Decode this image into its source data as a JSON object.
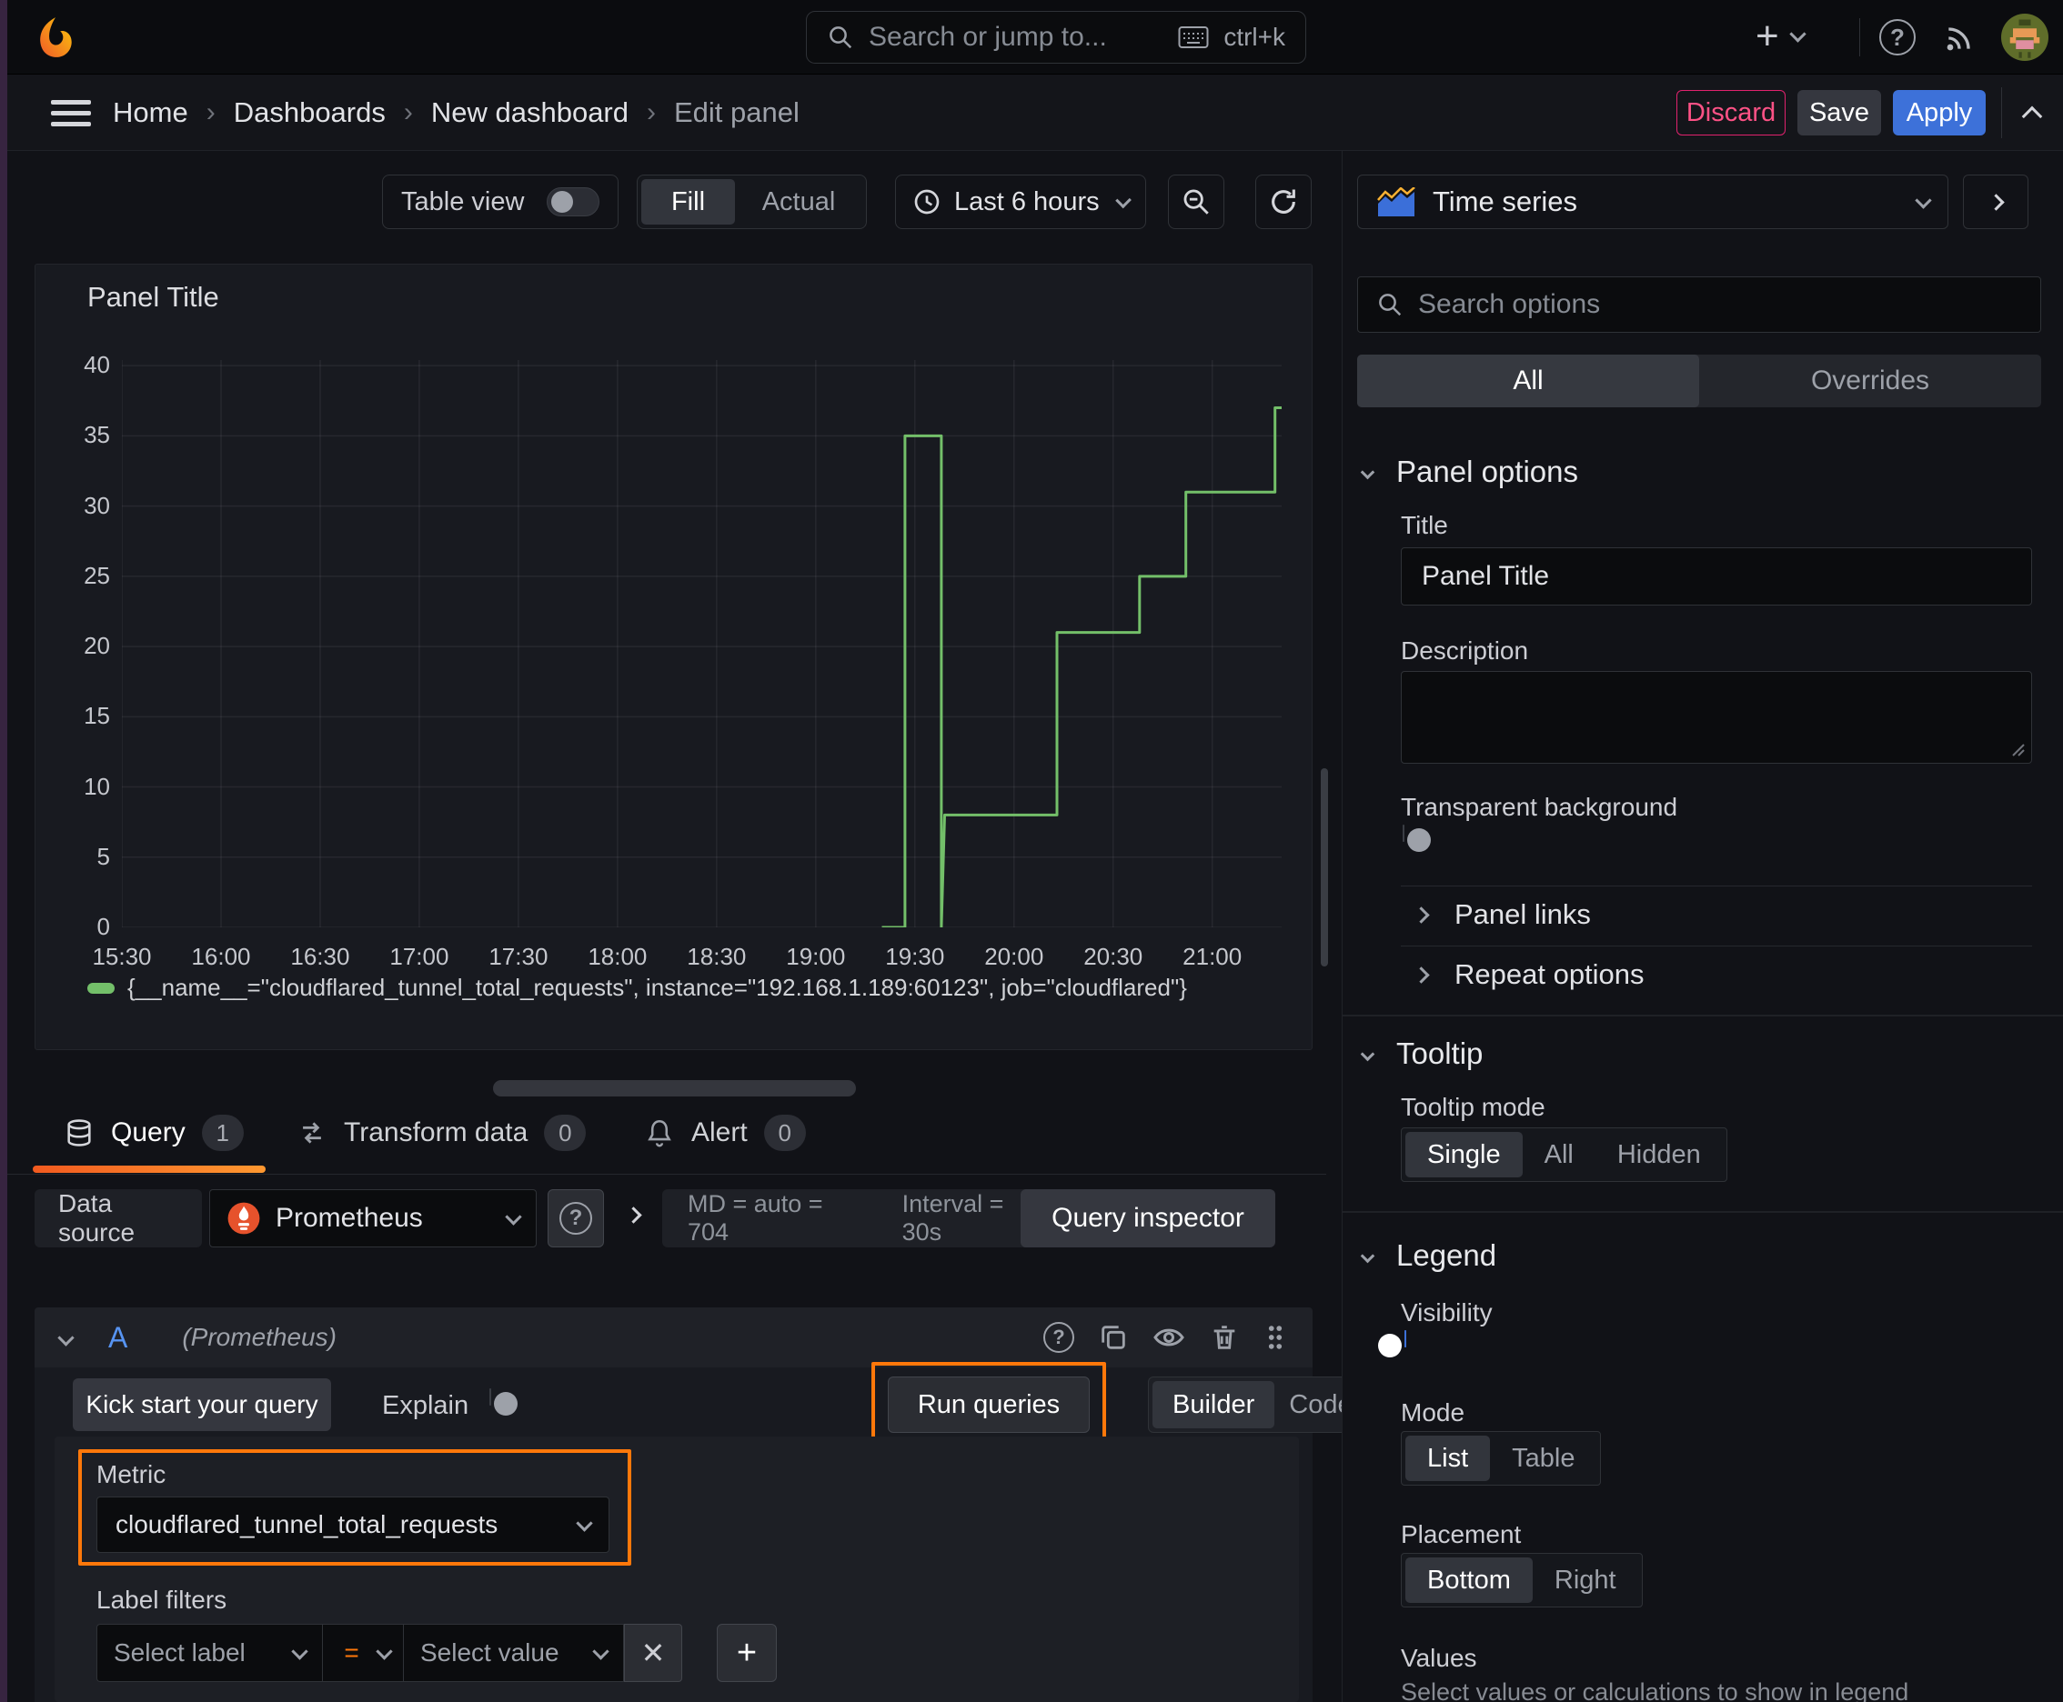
{
  "topbar": {
    "search_placeholder": "Search or jump to...",
    "search_shortcut": "ctrl+k"
  },
  "breadcrumb": {
    "items": [
      "Home",
      "Dashboards",
      "New dashboard",
      "Edit panel"
    ]
  },
  "actions": {
    "discard": "Discard",
    "save": "Save",
    "apply": "Apply"
  },
  "panel_toolbar": {
    "table_view_label": "Table view",
    "fill_label": "Fill",
    "actual_label": "Actual",
    "time_range": "Last 6 hours"
  },
  "viz_picker": {
    "selected": "Time series"
  },
  "options_pane": {
    "search_placeholder": "Search options",
    "tab_all": "All",
    "tab_overrides": "Overrides",
    "panel_options": {
      "header": "Panel options",
      "title_label": "Title",
      "title_value": "Panel Title",
      "description_label": "Description",
      "transparent_label": "Transparent background"
    },
    "panel_links": "Panel links",
    "repeat_options": "Repeat options",
    "tooltip": {
      "header": "Tooltip",
      "mode_label": "Tooltip mode",
      "mode_single": "Single",
      "mode_all": "All",
      "mode_hidden": "Hidden"
    },
    "legend": {
      "header": "Legend",
      "visibility_label": "Visibility",
      "mode_label": "Mode",
      "mode_list": "List",
      "mode_table": "Table",
      "placement_label": "Placement",
      "placement_bottom": "Bottom",
      "placement_right": "Right",
      "values_label": "Values",
      "values_hint": "Select values or calculations to show in legend"
    }
  },
  "query_pane": {
    "tab_query": "Query",
    "tab_query_count": "1",
    "tab_transform": "Transform data",
    "tab_transform_count": "0",
    "tab_alert": "Alert",
    "tab_alert_count": "0",
    "datasource_label": "Data source",
    "datasource_name": "Prometheus",
    "stats_md": "MD = auto = 704",
    "stats_interval": "Interval = 30s",
    "query_inspector": "Query inspector",
    "row_ref": "A",
    "row_ds": "(Prometheus)",
    "kick_start": "Kick start your query",
    "explain_label": "Explain",
    "run_queries": "Run queries",
    "builder": "Builder",
    "code": "Code",
    "metric_label": "Metric",
    "metric_value": "cloudflared_tunnel_total_requests",
    "label_filters_label": "Label filters",
    "select_label_placeholder": "Select label",
    "operator": "=",
    "select_value_placeholder": "Select value"
  },
  "colors": {
    "accent_orange": "#ff780a",
    "series_green": "#73BF69",
    "primary_blue": "#3d71d9",
    "discard_pink": "#ff5286"
  },
  "chart_data": {
    "type": "line",
    "title": "Panel Title",
    "x_ticks": [
      "15:30",
      "16:00",
      "16:30",
      "17:00",
      "17:30",
      "18:00",
      "18:30",
      "19:00",
      "19:30",
      "20:00",
      "20:30",
      "21:00"
    ],
    "x_start_minutes": 930,
    "x_tick_interval_minutes": 30,
    "x_end_minutes": 1281,
    "y_ticks": [
      0,
      5,
      10,
      15,
      20,
      25,
      30,
      35,
      40
    ],
    "ylim": [
      0,
      40.4
    ],
    "grid": true,
    "legend_position": "bottom",
    "series": [
      {
        "name": "{__name__=\"cloudflared_tunnel_total_requests\", instance=\"192.168.1.189:60123\", job=\"cloudflared\"}",
        "color": "#73BF69",
        "points": [
          [
            "19:20",
            0
          ],
          [
            "19:27",
            0
          ],
          [
            "19:27",
            35
          ],
          [
            "19:38",
            35
          ],
          [
            "19:38",
            0
          ],
          [
            "19:39",
            8
          ],
          [
            "20:13",
            8
          ],
          [
            "20:13",
            21
          ],
          [
            "20:38",
            21
          ],
          [
            "20:38",
            25
          ],
          [
            "20:52",
            25
          ],
          [
            "20:52",
            31
          ],
          [
            "21:19",
            31
          ],
          [
            "21:19",
            37
          ],
          [
            "21:21",
            37
          ]
        ]
      }
    ]
  }
}
